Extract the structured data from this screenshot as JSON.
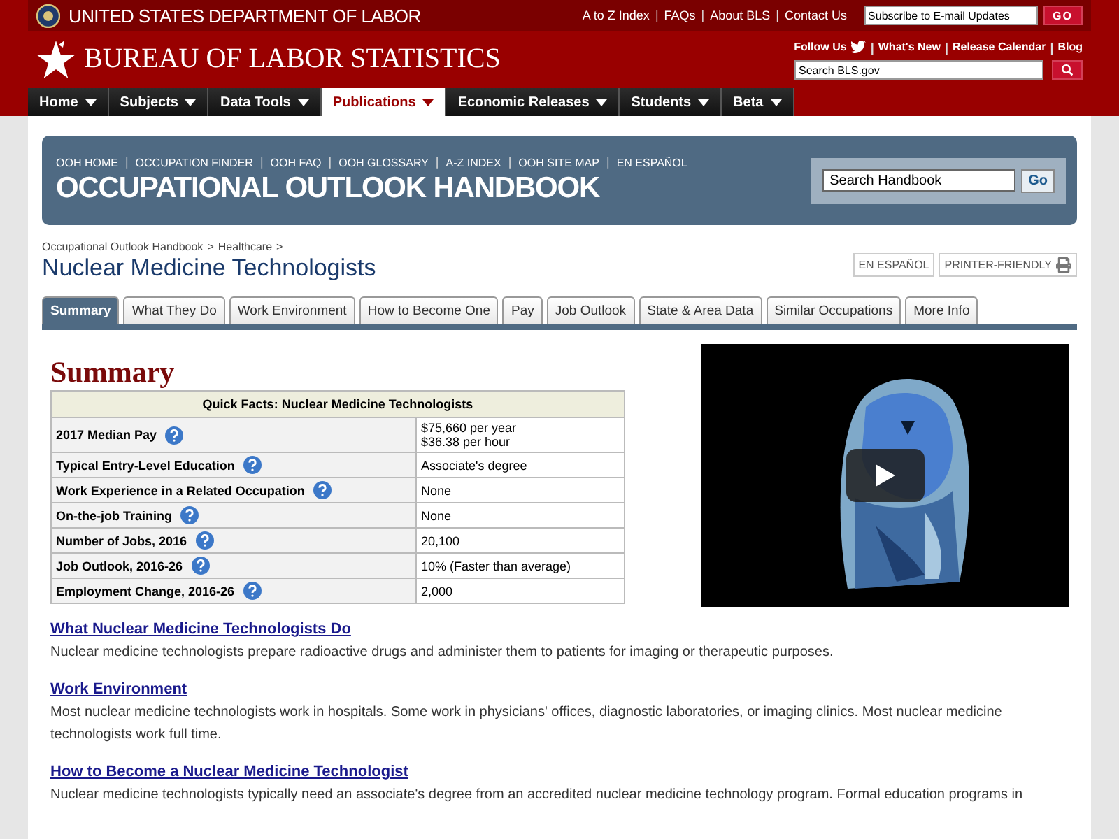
{
  "top_bar": {
    "department": "UNITED STATES DEPARTMENT OF LABOR",
    "links": [
      "A to Z Index",
      "FAQs",
      "About BLS",
      "Contact Us"
    ],
    "subscribe": {
      "placeholder": "Subscribe to E-mail Updates"
    },
    "go": "GO",
    "separator": "|"
  },
  "header": {
    "title": "BUREAU OF LABOR STATISTICS",
    "follow": "Follow Us",
    "links": [
      "What's New",
      "Release Calendar",
      "Blog"
    ],
    "separator": "|",
    "search": {
      "placeholder": "Search BLS.gov"
    }
  },
  "nav": [
    {
      "label": "Home",
      "selected": false
    },
    {
      "label": "Subjects",
      "selected": false
    },
    {
      "label": "Data Tools",
      "selected": false
    },
    {
      "label": "Publications",
      "selected": true
    },
    {
      "label": "Economic Releases",
      "selected": false
    },
    {
      "label": "Students",
      "selected": false
    },
    {
      "label": "Beta",
      "selected": false
    }
  ],
  "ooh": {
    "links": [
      "OOH HOME",
      "OCCUPATION FINDER",
      "OOH FAQ",
      "OOH GLOSSARY",
      "A-Z INDEX",
      "OOH SITE MAP",
      "EN ESPAÑOL"
    ],
    "title": "OCCUPATIONAL OUTLOOK HANDBOOK",
    "separator": "|",
    "search": {
      "value": "Search Handbook"
    },
    "go": "Go"
  },
  "breadcrumb": {
    "items": [
      "Occupational Outlook Handbook",
      "Healthcare"
    ],
    "separator": ">"
  },
  "page_title": "Nuclear Medicine Technologists",
  "page_buttons": [
    {
      "label": "EN ESPAÑOL",
      "kind": "text"
    },
    {
      "label": "PRINTER-FRIENDLY",
      "kind": "print"
    }
  ],
  "tabs": [
    {
      "label": "Summary",
      "selected": true
    },
    {
      "label": "What They Do",
      "selected": false
    },
    {
      "label": "Work Environment",
      "selected": false
    },
    {
      "label": "How to Become One",
      "selected": false
    },
    {
      "label": "Pay",
      "selected": false
    },
    {
      "label": "Job Outlook",
      "selected": false
    },
    {
      "label": "State & Area Data",
      "selected": false
    },
    {
      "label": "Similar Occupations",
      "selected": false
    },
    {
      "label": "More Info",
      "selected": false
    }
  ],
  "summary_heading": "Summary",
  "quick_facts": {
    "title": "Quick Facts: Nuclear Medicine Technologists",
    "rows": [
      {
        "label": "2017 Median Pay",
        "values": [
          "$75,660 per year",
          "$36.38 per hour"
        ]
      },
      {
        "label": "Typical Entry-Level Education",
        "values": [
          "Associate's degree"
        ]
      },
      {
        "label": "Work Experience in a Related Occupation",
        "values": [
          "None"
        ]
      },
      {
        "label": "On-the-job Training",
        "values": [
          "None"
        ]
      },
      {
        "label": "Number of Jobs, 2016",
        "values": [
          "20,100"
        ]
      },
      {
        "label": "Job Outlook, 2016-26",
        "values": [
          "10% (Faster than average)"
        ]
      },
      {
        "label": "Employment Change, 2016-26",
        "values": [
          "2,000"
        ]
      }
    ]
  },
  "sections": [
    {
      "heading": "What Nuclear Medicine Technologists Do",
      "text": "Nuclear medicine technologists prepare radioactive drugs and administer them to patients for imaging or therapeutic purposes."
    },
    {
      "heading": "Work Environment",
      "text": "Most nuclear medicine technologists work in hospitals. Some work in physicians' offices, diagnostic laboratories, or imaging clinics. Most nuclear medicine technologists work full time."
    },
    {
      "heading": "How to Become a Nuclear Medicine Technologist",
      "text": "Nuclear medicine technologists typically need an associate's degree from an accredited nuclear medicine technology program. Formal education programs in"
    }
  ]
}
